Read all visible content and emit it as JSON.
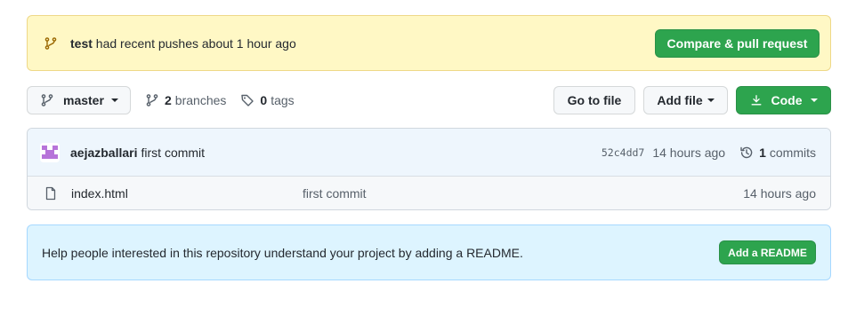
{
  "flash": {
    "branch": "test",
    "message": "had recent pushes about 1 hour ago",
    "compare_label": "Compare & pull request"
  },
  "toolbar": {
    "branch_name": "master",
    "branches_count": "2",
    "branches_label": "branches",
    "tags_count": "0",
    "tags_label": "tags",
    "go_to_file": "Go to file",
    "add_file": "Add file",
    "code": "Code"
  },
  "commit": {
    "author": "aejazballari",
    "message": "first commit",
    "sha": "52c4dd7",
    "age": "14 hours ago",
    "commits_count": "1",
    "commits_label": "commits"
  },
  "files": [
    {
      "name": "index.html",
      "message": "first commit",
      "age": "14 hours ago"
    }
  ],
  "readme": {
    "message": "Help people interested in this repository understand your project by adding a README.",
    "button": "Add a README"
  },
  "colors": {
    "green": "#2da44e",
    "flash_bg": "#fff8c5",
    "readme_bg": "#ddf4ff"
  }
}
